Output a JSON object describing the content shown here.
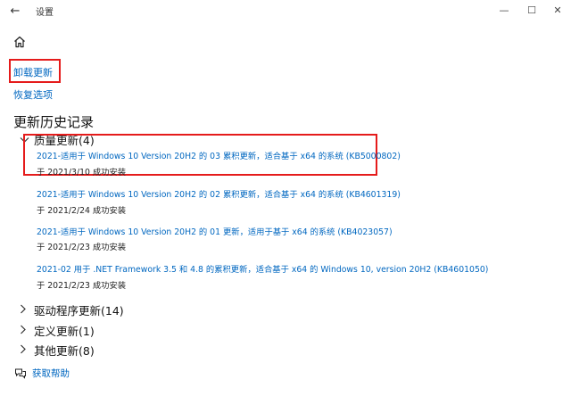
{
  "window": {
    "title": "设置",
    "back_glyph": "←",
    "minimize_glyph": "—",
    "maximize_glyph": "☐",
    "close_glyph": "✕"
  },
  "nav": {
    "uninstall_label": "卸载更新",
    "recovery_label": "恢复选项"
  },
  "section_title": "更新历史记录",
  "groups": {
    "quality": {
      "label": "质量更新(4)",
      "expanded": true,
      "items": [
        {
          "title": "2021-适用于 Windows 10 Version 20H2 的 03 累积更新，适合基于 x64 的系统 (KB5000802)",
          "status": "于 2021/3/10 成功安装"
        },
        {
          "title": "2021-适用于 Windows 10 Version 20H2 的 02 累积更新，适合基于 x64 的系统 (KB4601319)",
          "status": "于 2021/2/24 成功安装"
        },
        {
          "title": "2021-适用于 Windows 10 Version 20H2 的 01 更新，适用于基于 x64 的系统 (KB4023057)",
          "status": "于 2021/2/23 成功安装"
        },
        {
          "title": "2021-02 用于 .NET Framework 3.5 和 4.8 的累积更新，适合基于 x64 的 Windows 10, version 20H2 (KB4601050)",
          "status": "于 2021/2/23 成功安装"
        }
      ]
    },
    "driver": {
      "label": "驱动程序更新(14)",
      "expanded": false
    },
    "definition": {
      "label": "定义更新(1)",
      "expanded": false
    },
    "other": {
      "label": "其他更新(8)",
      "expanded": false
    }
  },
  "help": {
    "label": "获取帮助"
  },
  "colors": {
    "link": "#0067c0",
    "highlight_box": "#e51b1b"
  }
}
